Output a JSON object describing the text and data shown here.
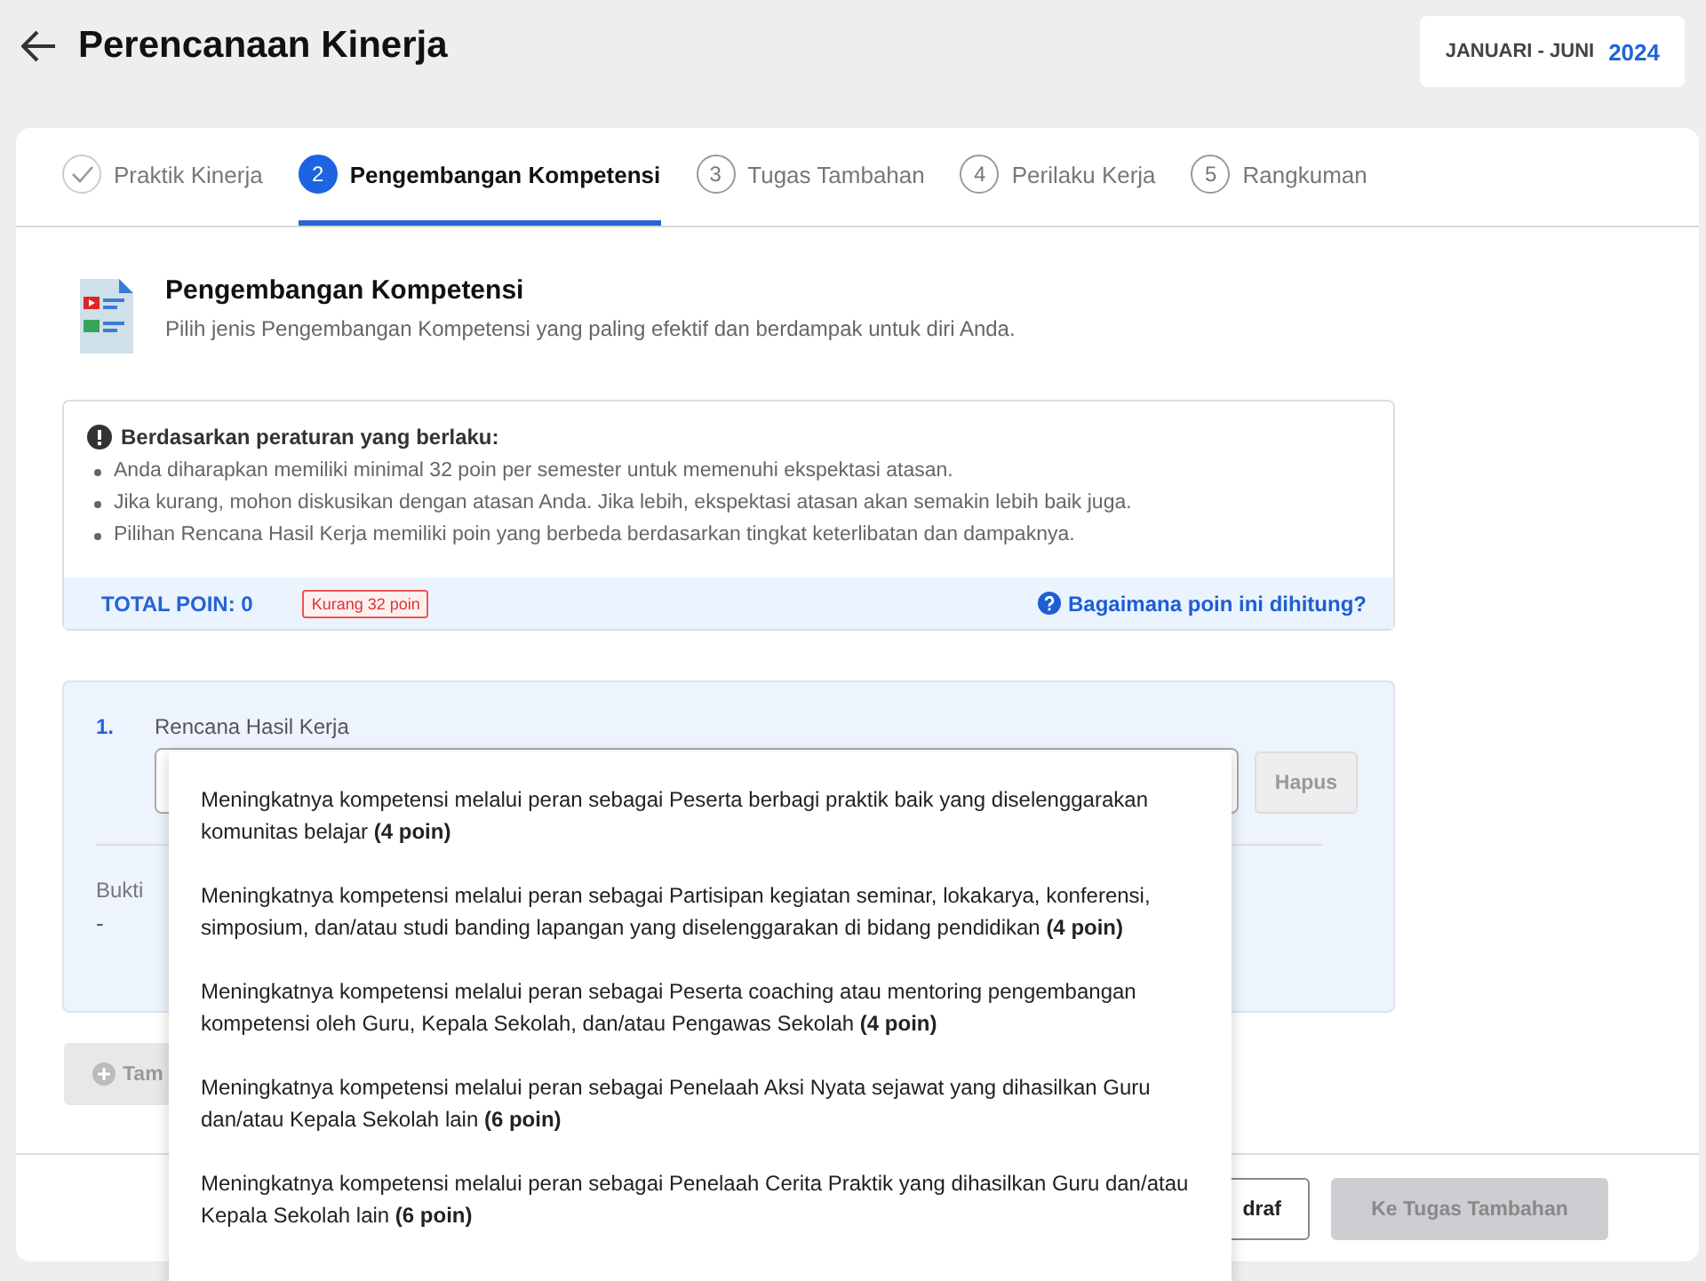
{
  "header": {
    "title": "Perencanaan Kinerja",
    "period": "JANUARI - JUNI",
    "year": "2024"
  },
  "steps": [
    {
      "label": "Praktik Kinerja",
      "done": true,
      "selected": false
    },
    {
      "number": "2",
      "label": "Pengembangan Kompetensi",
      "done": false,
      "selected": true
    },
    {
      "number": "3",
      "label": "Tugas Tambahan",
      "done": false,
      "selected": false
    },
    {
      "number": "4",
      "label": "Perilaku Kerja",
      "done": false,
      "selected": false
    },
    {
      "number": "5",
      "label": "Rangkuman",
      "done": false,
      "selected": false
    }
  ],
  "section": {
    "title": "Pengembangan Kompetensi",
    "subtitle": "Pilih jenis Pengembangan Kompetensi yang paling efektif dan berdampak untuk diri Anda."
  },
  "info": {
    "title": "Berdasarkan peraturan yang berlaku:",
    "bullets": [
      "Anda diharapkan memiliki minimal 32 poin per semester untuk memenuhi ekspektasi atasan.",
      "Jika kurang, mohon diskusikan dengan atasan Anda. Jika lebih, ekspektasi atasan akan semakin lebih baik juga.",
      "Pilihan Rencana Hasil Kerja memiliki poin yang berbeda berdasarkan tingkat keterlibatan dan dampaknya."
    ],
    "total": "TOTAL POIN: 0",
    "badge": "Kurang 32 poin",
    "help_link": "Bagaimana poin ini dihitung?"
  },
  "item": {
    "number": "1.",
    "label": "Rencana Hasil Kerja",
    "delete_button": "Hapus",
    "evidence_label": "Bukti",
    "evidence_value": "-"
  },
  "add_button": "Tam",
  "footer": {
    "draft_button": "draf",
    "next_button": "Ke Tugas Tambahan",
    "next_disabled": true
  },
  "dropdown": {
    "options": [
      "Meningkatnya kompetensi melalui peran sebagai Peserta berbagi praktik baik yang diselenggarakan komunitas belajar **(4 poin)**",
      "Meningkatnya kompetensi melalui peran sebagai Partisipan kegiatan seminar, lokakarya, konferensi, simposium, dan/atau studi banding lapangan yang diselenggarakan di bidang pendidikan **(4 poin)**",
      "Meningkatnya kompetensi melalui peran sebagai Peserta coaching atau mentoring pengembangan kompetensi oleh Guru, Kepala Sekolah, dan/atau Pengawas Sekolah **(4 poin)**",
      "Meningkatnya kompetensi melalui peran sebagai Penelaah Aksi Nyata sejawat yang dihasilkan Guru dan/atau Kepala Sekolah lain **(6 poin)**",
      "Meningkatnya kompetensi melalui peran sebagai Penelaah Cerita Praktik yang dihasilkan Guru dan/atau Kepala Sekolah lain **(6 poin)**"
    ]
  }
}
